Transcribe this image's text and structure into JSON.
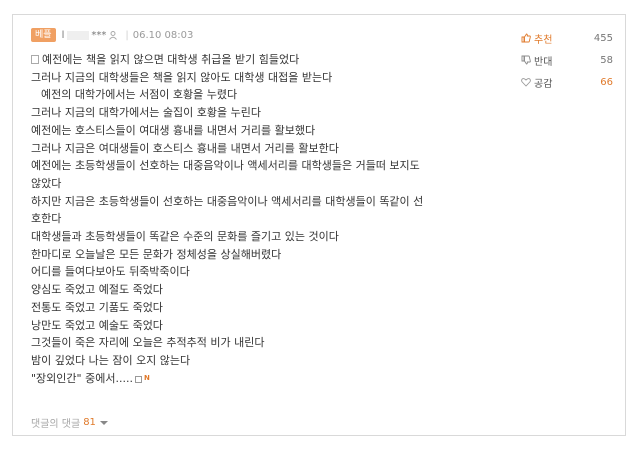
{
  "comment": {
    "badge": "베플",
    "nickname_visible": "l",
    "nickname_mask": "***",
    "date": "06.10 08:03",
    "lines": [
      "예전에는 책을 읽지 않으면 대학생 취급을 받기 힘들었다",
      "그러나 지금의 대학생들은 책을 읽지 않아도 대학생 대접을 받는다",
      "예전의 대학가에서는 서점이 호황을 누렸다",
      "그러나 지금의 대학가에서는 술집이 호황을 누린다",
      "예전에는 호스티스들이 여대생 흉내를 내면서 거리를 활보했다",
      "그러나 지금은 여대생들이 호스티스 흉내를 내면서 거리를 활보한다",
      "예전에는 초등학생들이 선호하는 대중음악이나 액세서리를   대학생들은 거들떠 보지도",
      "않았다",
      "하지만 지금은 초등학생들이 선호하는 대중음악이나 액세서리를   대학생들이 똑같이 선",
      "호한다",
      "대학생들과 초등학생들이 똑같은 수준의 문화를 즐기고 있는 것이다",
      "한마디로 오늘날은 모든 문화가 정체성을 상실해버렸다",
      "어디를 들여다보아도 뒤죽박죽이다",
      "양심도 죽었고 예절도 죽었다",
      "전통도 죽었고 기품도 죽었다",
      "낭만도 죽었고 예술도 죽었다",
      "그것들이 죽은 자리에 오늘은 추적추적 비가 내린다",
      "밤이 깊었다   나는 잠이 오지 않는다",
      "\"장외인간\" 중에서.....",
      ""
    ],
    "inline_new_mark": "N",
    "reply_label": "댓글의 댓글",
    "reply_count": "81"
  },
  "votes": {
    "recommend_label": "추천",
    "recommend_count": "455",
    "oppose_label": "반대",
    "oppose_count": "58",
    "empathy_label": "공감",
    "empathy_count": "66"
  },
  "colors": {
    "accent": "#e07a2b",
    "badge": "#f0a063",
    "text": "#333333",
    "muted": "#9a9a9a"
  },
  "icons": [
    "user-icon",
    "document-icon",
    "thumb-up-icon",
    "thumb-down-icon",
    "heart-icon",
    "chevron-down-icon"
  ]
}
